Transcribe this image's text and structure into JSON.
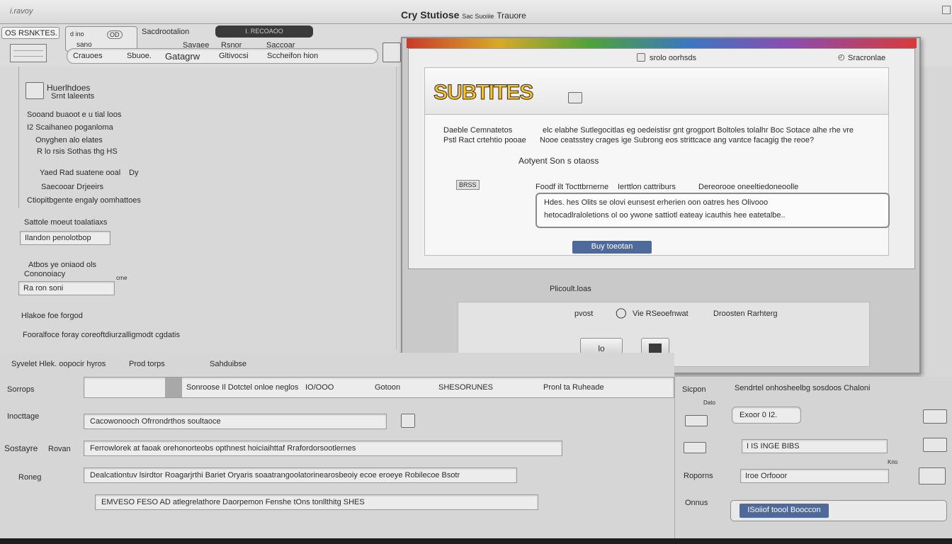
{
  "window": {
    "title_left": "Cry Stutiose",
    "title_mid": "Sac Suoiiie",
    "title_right": "Trauore",
    "corner_label": "i.ravoy"
  },
  "toolbar": {
    "tab_label": "OS RSNKTES.",
    "tab_field_label": "d ino",
    "tab_field_icon_text": "OD",
    "menu_1": "Sacdrootalion",
    "dark_button": "I. RECOAOO",
    "row2_items": [
      "Crauoes",
      "Sbuoe.",
      "Gatagrw",
      "Gltivocsi",
      "Sccheifon hion"
    ],
    "row1_items": [
      "Savaee",
      "Rsnor",
      "Saccoar"
    ],
    "row0_label": "sano"
  },
  "left_panel": {
    "app_name_1": "Huerlhdoes",
    "app_name_2": "Srnt laleents",
    "list_items": [
      "Sooand buaoot e u tial loos",
      "I2 Scaihaneo poganloma",
      "Onyghen alo elates",
      "R lo rsis Sothas thg HS"
    ],
    "row_a": "Yaed Rad suatene ooal",
    "row_a_right": "Dy",
    "row_b": "Saecooar Drjeeirs",
    "row_c": "Ctiopitbgente engaly oomhattoes",
    "section_label": "Sattole moeut toalatiaxs",
    "dropdown_1": "Ilandon penolotbop",
    "row_d_1": "Atbos ye oniaod ols",
    "row_d_2": "Cononoiacy",
    "dropdown_2": "Ra ron soni",
    "side_tiny": "crne",
    "row_e": "Hlakoe foe forgod",
    "row_f": "Fooralfoce foray coreoftdiurzalligmodt cgdatis"
  },
  "dialog": {
    "header_title": "srolo oorhsds",
    "header_right": "Sracronlae",
    "logo_text": "SUBTITES",
    "desc_label_1": "Daeble Cemnatetos",
    "desc_label_2": "Pstl Ract crtehtio pooae",
    "desc_text_1": "elc elabhe Sutlegocitlas eg oedeistisr gnt grogport Boltoles tolalhr Boc Sotace alhe rhe vre",
    "desc_text_2": "Nooe ceatsstey crages ige Subrong eos strittcace ang vantce facagig the reoe?",
    "sub_heading": "Aotyent Son s otaoss",
    "ribbon_tag": "BRSS",
    "info_head_left": "Foodf ilt Tocttbrnerne",
    "info_head_mid": "Ierttlon cattriburs",
    "info_head_right": "Dereorooe oneeltiedoneoolle",
    "info_line_1": "Hdes. hes Olits se olovi eunsest erherien oon oatres hes Olivooo",
    "info_line_2": "hetocadlraloletions ol oo ywone sattiotl eateay icauthis hee eatetalbe..",
    "primary_button": "Buy toeotan",
    "lower_label": "Plicoult.loas",
    "action_1": "pvost",
    "action_2": "Vie RSeoefnwat",
    "action_3": "Droosten Rarhterg",
    "box_1_text": "lo"
  },
  "props": {
    "header_items": [
      "Syvelet Hlek. oopocir hyros",
      "Prod torps",
      "Sahduibse"
    ],
    "label_1": "Sorrops",
    "field_1_right": "Sonroose Il Dotctel onloe neglos",
    "field_1_val": "IO/OOO",
    "col_1": "Gotoon",
    "col_2": "SHESORUNES",
    "col_3": "Pronl ta Ruheade",
    "label_2": "Inocttage",
    "field_2": "Cacowonooch Ofrrondrthos soultaoce",
    "label_3": "Sostayre",
    "label_3b": "Rovan",
    "field_3": "Ferrowlorek at faoak orehonorteobs opthnest hoiciaihttaf Rrafordorsootlernes",
    "label_4": "Roneg",
    "field_4": "Dealcationtuv lsirdtor Roagarjrthi Bariet Oryaris soaatrangoolatorinearosbeoiy ecoe eroeye Robilecoe Bsotr",
    "field_5": "EMVESO FESO AD atlegrelathore Daorpemon Fenshe tOns tonllthitg SHES"
  },
  "right_panel": {
    "label_a": "Sicpon",
    "label_a_right": "Sendrtel onhosheelbg sosdoos Chaloni",
    "tiny_1": "Dato",
    "input_a": "Exoor 0 I2.",
    "input_b": "I IS INGE BIBS",
    "tiny_2": "Krio",
    "label_b": "Roporns",
    "input_c": "Iroe Orfooor",
    "label_c": "Onnus",
    "button": "ISoiiof toool Booccon"
  },
  "colors": {
    "accent_blue": "#4f6a9a",
    "dark_button": "#3a3a3a",
    "rainbow": [
      "#c83a2a",
      "#d8a92a",
      "#4fa23c",
      "#3a78c0",
      "#8a4cb0",
      "#d83a3a"
    ]
  }
}
